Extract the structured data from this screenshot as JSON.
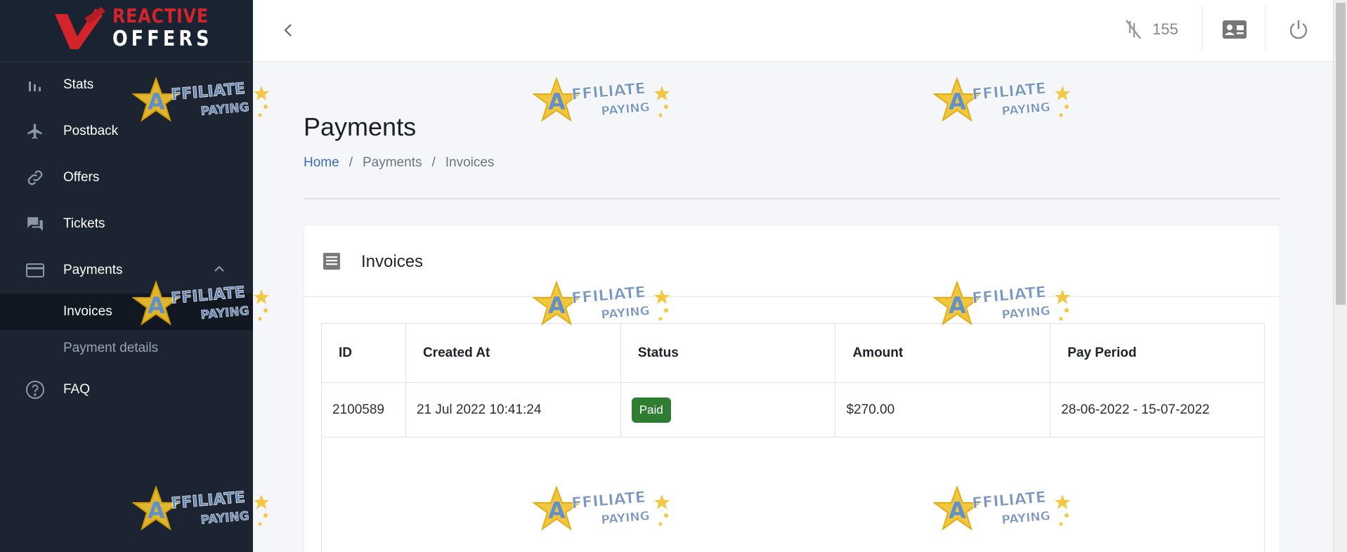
{
  "brand": {
    "line1": "REACTIVE",
    "line2": "OFFERS"
  },
  "sidebar": {
    "items": [
      {
        "label": "Stats",
        "icon": "bar-chart-icon"
      },
      {
        "label": "Postback",
        "icon": "airplane-icon"
      },
      {
        "label": "Offers",
        "icon": "link-icon"
      },
      {
        "label": "Tickets",
        "icon": "chat-icon"
      },
      {
        "label": "Payments",
        "icon": "credit-card-icon",
        "expanded": true,
        "children": [
          {
            "label": "Invoices",
            "active": true
          },
          {
            "label": "Payment details",
            "active": false
          }
        ]
      },
      {
        "label": "FAQ",
        "icon": "question-icon"
      }
    ]
  },
  "topbar": {
    "count": "155"
  },
  "page": {
    "title": "Payments",
    "breadcrumb": [
      "Home",
      "Payments",
      "Invoices"
    ]
  },
  "card": {
    "title": "Invoices"
  },
  "table": {
    "headers": [
      "ID",
      "Created At",
      "Status",
      "Amount",
      "Pay Period"
    ],
    "rows": [
      {
        "id": "2100589",
        "created_at": "21 Jul 2022 10:41:24",
        "status": "Paid",
        "amount": "$270.00",
        "pay_period": "28-06-2022 - 15-07-2022"
      }
    ]
  },
  "watermark": {
    "line1": "FFILIATE",
    "line2": "PAYING",
    "letter": "A"
  },
  "colors": {
    "sidebar": "#1c2431",
    "accent_link": "#3e6cb0",
    "paid_badge": "#2e7d32",
    "brand_red": "#d3232b"
  }
}
